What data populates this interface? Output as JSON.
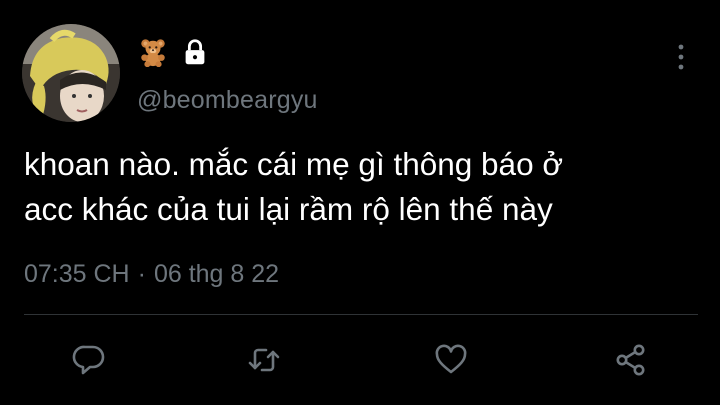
{
  "user": {
    "handle": "@beombeargyu",
    "badge_icon": "teddy-bear-emoji",
    "protected_icon": "lock-icon"
  },
  "tweet": {
    "text_line1": "khoan nào. mắc cái mẹ gì thông báo ở",
    "text_line2": "acc khác của tui lại rầm rộ lên thế này",
    "time": "07:35 CH",
    "separator": "·",
    "date": "06 thg 8 22"
  },
  "actions": [
    "reply-icon",
    "retweet-icon",
    "like-icon",
    "share-icon"
  ],
  "colors": {
    "background": "#000000",
    "text": "#ffffff",
    "secondary": "#6e767d",
    "divider": "#2f3336",
    "icon": "#6e767d"
  }
}
